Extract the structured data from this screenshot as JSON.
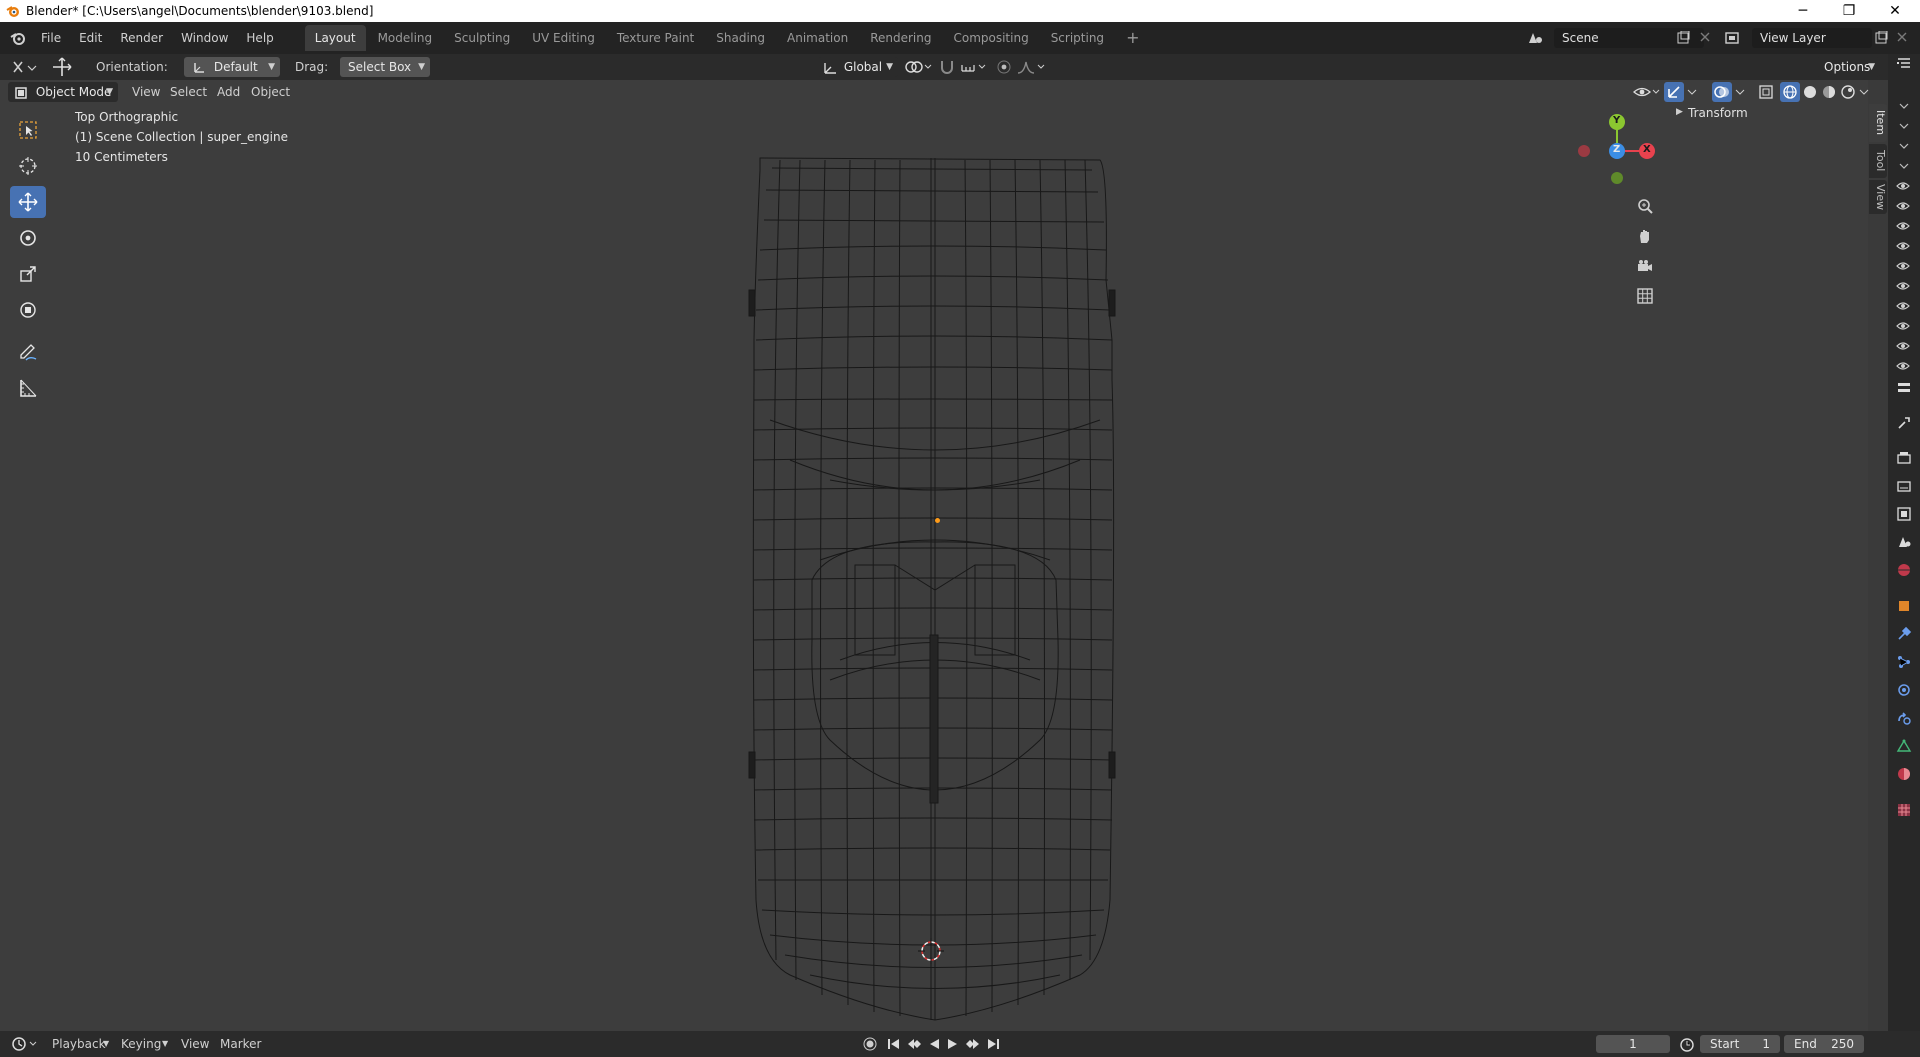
{
  "window": {
    "title": "Blender* [C:\\Users\\angel\\Documents\\blender\\9103.blend]",
    "minimize_glyph": "─",
    "restore_glyph": "❐",
    "close_glyph": "✕"
  },
  "menubar": {
    "items": [
      "File",
      "Edit",
      "Render",
      "Window",
      "Help"
    ]
  },
  "workspaces": {
    "tabs": [
      "Layout",
      "Modeling",
      "Sculpting",
      "UV Editing",
      "Texture Paint",
      "Shading",
      "Animation",
      "Rendering",
      "Compositing",
      "Scripting"
    ],
    "active": "Layout",
    "add_glyph": "+"
  },
  "scene": {
    "name": "Scene"
  },
  "view_layer": {
    "name": "View Layer"
  },
  "tool_header": {
    "orientation_label": "Orientation:",
    "orientation_value": "Default",
    "drag_label": "Drag:",
    "drag_value": "Select Box",
    "transform_orientation": "Global",
    "options_label": "Options"
  },
  "viewport_header": {
    "mode": "Object Mode",
    "menus": [
      "View",
      "Select",
      "Add",
      "Object"
    ]
  },
  "viewport": {
    "view_name": "Top Orthographic",
    "collection_info": "(1) Scene Collection | super_engine",
    "grid_scale": "10 Centimeters"
  },
  "gizmo": {
    "y_label": "Y",
    "z_label": "Z",
    "x_label": "X",
    "colors": {
      "x": "#e8424e",
      "y": "#8bc730",
      "z": "#3c8ee4"
    }
  },
  "sidebar": {
    "panel_title": "Transform",
    "tabs": [
      "Item",
      "Tool",
      "View"
    ]
  },
  "timeline": {
    "menus": [
      "Playback",
      "Keying",
      "View",
      "Marker"
    ],
    "current_frame": "1",
    "start_label": "Start",
    "start_value": "1",
    "end_label": "End",
    "end_value": "250"
  },
  "theme": {
    "active_tool": "#4772b3",
    "origin_dot": "#ff9c1a"
  }
}
